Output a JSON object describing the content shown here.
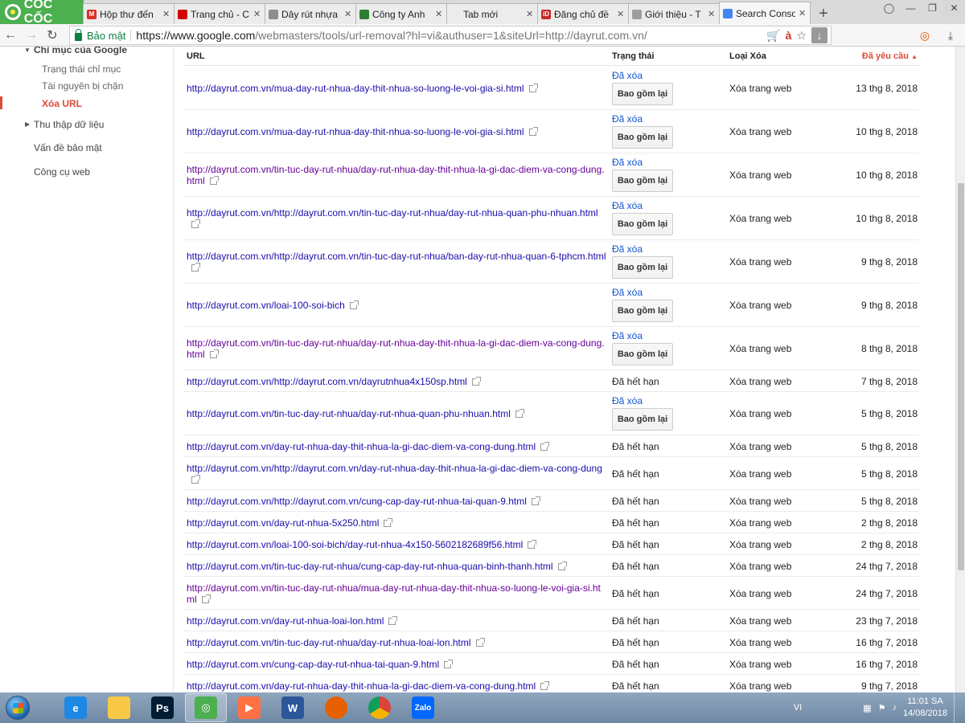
{
  "browser": {
    "logo_text": "CỐC CỐC",
    "tabs": [
      {
        "title": "Hộp thư đến",
        "favicon": "gmail-icon",
        "color": "#d93025",
        "glyph": "M"
      },
      {
        "title": "Trang chủ - C",
        "favicon": "red-circle-icon",
        "color": "#d50000",
        "glyph": ""
      },
      {
        "title": "Dây rút nhựa",
        "favicon": "page-icon",
        "color": "#8d8d8d",
        "glyph": ""
      },
      {
        "title": "Công ty Anh",
        "favicon": "globe-icon",
        "color": "#2e7d32",
        "glyph": ""
      },
      {
        "title": "Tab mới",
        "favicon": "",
        "color": "",
        "glyph": ""
      },
      {
        "title": "Đăng chủ đề",
        "favicon": "idvs-icon",
        "color": "#c62828",
        "glyph": "iD"
      },
      {
        "title": "Giới thiệu - T",
        "favicon": "page-icon",
        "color": "#9e9e9e",
        "glyph": ""
      },
      {
        "title": "Search Conso",
        "favicon": "search-console-icon",
        "color": "#4285f4",
        "glyph": ""
      }
    ],
    "new_tab_label": "+",
    "secure_label": "Bảo mật",
    "url_host": "https://www.google.com",
    "url_rest": "/webmasters/tools/url-removal?hl=vi&authuser=1&siteUrl=http://dayrut.com.vn/"
  },
  "sidebar": {
    "section_title": "Chỉ mục của Google",
    "items": [
      {
        "label": "Trạng thái chỉ mục"
      },
      {
        "label": "Tài nguyên bị chặn"
      },
      {
        "label": "Xóa URL"
      },
      {
        "label": "Thu thập dữ liệu"
      },
      {
        "label": "Vấn đề bảo mật"
      },
      {
        "label": "Công cụ web"
      }
    ]
  },
  "table": {
    "headers": {
      "url": "URL",
      "status": "Trạng thái",
      "type": "Loại Xóa",
      "date": "Đã yêu cầu"
    },
    "sort_indicator": "▲",
    "reinclude_label": "Bao gồm lại",
    "rows": [
      {
        "url": "http://dayrut.com.vn/mua-day-rut-nhua-day-thit-nhua-so-luong-le-voi-gia-si.html",
        "status": "Đã xóa",
        "type": "Xóa trang web",
        "date": "13 thg 8, 2018"
      },
      {
        "url": "http://dayrut.com.vn/mua-day-rut-nhua-day-thit-nhua-so-luong-le-voi-gia-si.html",
        "status": "Đã xóa",
        "type": "Xóa trang web",
        "date": "10 thg 8, 2018"
      },
      {
        "url": "http://dayrut.com.vn/tin-tuc-day-rut-nhua/day-rut-nhua-day-thit-nhua-la-gi-dac-diem-va-cong-dung.html",
        "status": "Đã xóa",
        "type": "Xóa trang web",
        "date": "10 thg 8, 2018"
      },
      {
        "url": "http://dayrut.com.vn/http://dayrut.com.vn/tin-tuc-day-rut-nhua/day-rut-nhua-quan-phu-nhuan.html",
        "status": "Đã xóa",
        "type": "Xóa trang web",
        "date": "10 thg 8, 2018"
      },
      {
        "url": "http://dayrut.com.vn/http://dayrut.com.vn/tin-tuc-day-rut-nhua/ban-day-rut-nhua-quan-6-tphcm.html",
        "status": "Đã xóa",
        "type": "Xóa trang web",
        "date": "9 thg 8, 2018"
      },
      {
        "url": "http://dayrut.com.vn/loai-100-soi-bich",
        "status": "Đã xóa",
        "type": "Xóa trang web",
        "date": "9 thg 8, 2018"
      },
      {
        "url": "http://dayrut.com.vn/tin-tuc-day-rut-nhua/day-rut-nhua-day-thit-nhua-la-gi-dac-diem-va-cong-dung.html",
        "status": "Đã xóa",
        "type": "Xóa trang web",
        "date": "8 thg 8, 2018"
      },
      {
        "url": "http://dayrut.com.vn/http://dayrut.com.vn/dayrutnhua4x150sp.html",
        "status": "Đã hết hạn",
        "type": "Xóa trang web",
        "date": "7 thg 8, 2018"
      },
      {
        "url": "http://dayrut.com.vn/tin-tuc-day-rut-nhua/day-rut-nhua-quan-phu-nhuan.html",
        "status": "Đã xóa",
        "type": "Xóa trang web",
        "date": "5 thg 8, 2018"
      },
      {
        "url": "http://dayrut.com.vn/day-rut-nhua-day-thit-nhua-la-gi-dac-diem-va-cong-dung.html",
        "status": "Đã hết hạn",
        "type": "Xóa trang web",
        "date": "5 thg 8, 2018"
      },
      {
        "url": "http://dayrut.com.vn/http://dayrut.com.vn/day-rut-nhua-day-thit-nhua-la-gi-dac-diem-va-cong-dung",
        "status": "Đã hết hạn",
        "type": "Xóa trang web",
        "date": "5 thg 8, 2018"
      },
      {
        "url": "http://dayrut.com.vn/http://dayrut.com.vn/cung-cap-day-rut-nhua-tai-quan-9.html",
        "status": "Đã hết hạn",
        "type": "Xóa trang web",
        "date": "5 thg 8, 2018"
      },
      {
        "url": "http://dayrut.com.vn/day-rut-nhua-5x250.html",
        "status": "Đã hết hạn",
        "type": "Xóa trang web",
        "date": "2 thg 8, 2018"
      },
      {
        "url": "http://dayrut.com.vn/loai-100-soi-bich/day-rut-nhua-4x150-5602182689f56.html",
        "status": "Đã hết hạn",
        "type": "Xóa trang web",
        "date": "2 thg 8, 2018"
      },
      {
        "url": "http://dayrut.com.vn/tin-tuc-day-rut-nhua/cung-cap-day-rut-nhua-quan-binh-thanh.html",
        "status": "Đã hết hạn",
        "type": "Xóa trang web",
        "date": "24 thg 7, 2018"
      },
      {
        "url": "http://dayrut.com.vn/tin-tuc-day-rut-nhua/mua-day-rut-nhua-day-thit-nhua-so-luong-le-voi-gia-si.html",
        "status": "Đã hết hạn",
        "type": "Xóa trang web",
        "date": "24 thg 7, 2018"
      },
      {
        "url": "http://dayrut.com.vn/day-rut-nhua-loai-lon.html",
        "status": "Đã hết hạn",
        "type": "Xóa trang web",
        "date": "23 thg 7, 2018"
      },
      {
        "url": "http://dayrut.com.vn/tin-tuc-day-rut-nhua/day-rut-nhua-loai-lon.html",
        "status": "Đã hết hạn",
        "type": "Xóa trang web",
        "date": "16 thg 7, 2018"
      },
      {
        "url": "http://dayrut.com.vn/cung-cap-day-rut-nhua-tai-quan-9.html",
        "status": "Đã hết hạn",
        "type": "Xóa trang web",
        "date": "16 thg 7, 2018"
      },
      {
        "url": "http://dayrut.com.vn/day-rut-nhua-day-thit-nhua-la-gi-dac-diem-va-cong-dung.html",
        "status": "Đã hết hạn",
        "type": "Xóa trang web",
        "date": "9 thg 7, 2018"
      }
    ]
  },
  "taskbar": {
    "apps": [
      {
        "name": "internet-explorer-icon",
        "color": "#1e88e5",
        "glyph": "e"
      },
      {
        "name": "file-explorer-icon",
        "color": "#f9c846",
        "glyph": ""
      },
      {
        "name": "photoshop-icon",
        "color": "#001d34",
        "glyph": "Ps"
      },
      {
        "name": "coccoc-icon",
        "color": "#4caf50",
        "glyph": "◎"
      },
      {
        "name": "media-player-icon",
        "color": "#ff7043",
        "glyph": "▶"
      },
      {
        "name": "word-icon",
        "color": "#2b579a",
        "glyph": "W"
      },
      {
        "name": "firefox-icon",
        "color": "#e66000",
        "glyph": ""
      },
      {
        "name": "chrome-icon",
        "color": "#db4437",
        "glyph": ""
      },
      {
        "name": "zalo-icon",
        "color": "#0068ff",
        "glyph": "Zalo"
      }
    ],
    "language": "VI",
    "time": "11:01 SA",
    "date": "14/08/2018"
  }
}
